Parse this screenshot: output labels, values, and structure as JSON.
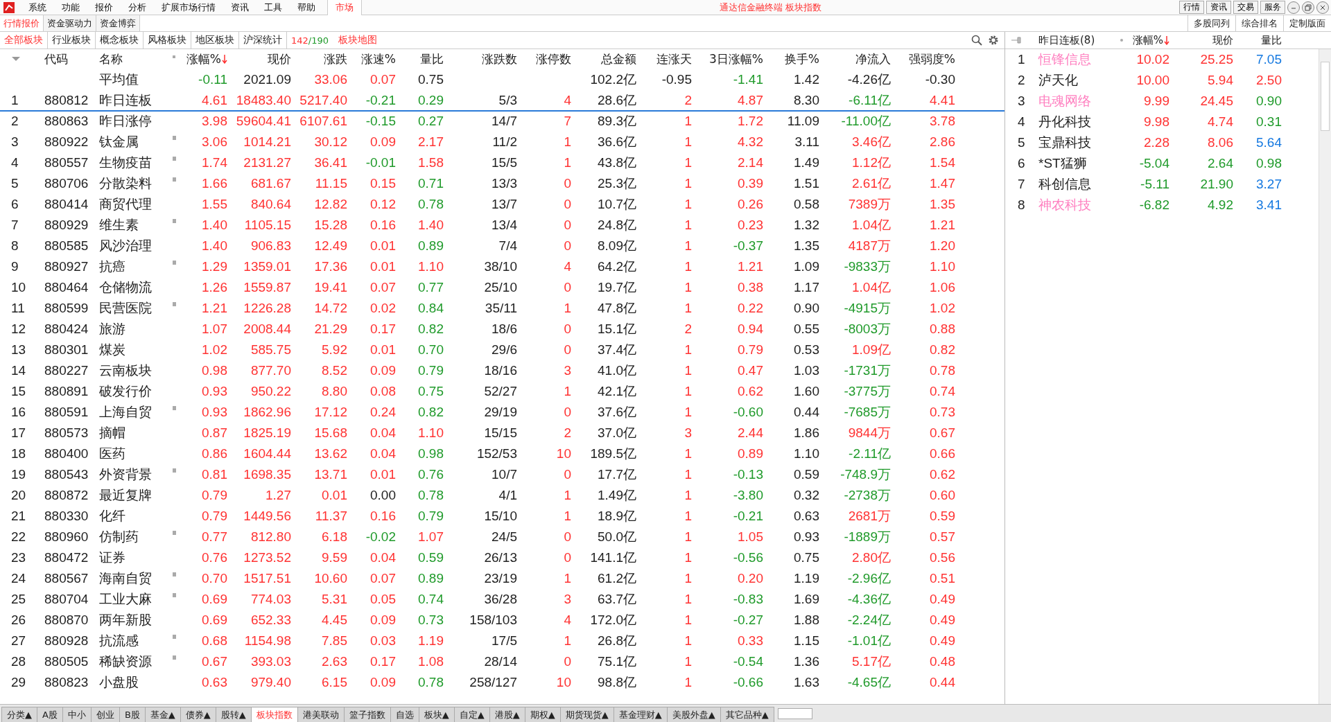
{
  "menubar": {
    "items": [
      {
        "label": "系统",
        "selected": false
      },
      {
        "label": "功能",
        "selected": false
      },
      {
        "label": "报价",
        "selected": false
      },
      {
        "label": "分析",
        "selected": false
      },
      {
        "label": "扩展市场行情",
        "selected": false
      },
      {
        "label": "资讯",
        "selected": false
      },
      {
        "label": "工具",
        "selected": false
      },
      {
        "label": "帮助",
        "selected": false
      },
      {
        "label": "市场",
        "selected": true
      }
    ],
    "title": "通达信金融终端 板块指数",
    "buttons": [
      "行情",
      "资讯",
      "交易",
      "服务"
    ]
  },
  "view_tabs": [
    {
      "label": "行情报价",
      "selected": true
    },
    {
      "label": "资金驱动力",
      "selected": false
    },
    {
      "label": "资金博弈",
      "selected": false
    }
  ],
  "layout_buttons": [
    "多股同列",
    "综合排名",
    "定制版面"
  ],
  "sector_tabs": [
    {
      "label": "全部板块",
      "selected": true
    },
    {
      "label": "行业板块",
      "selected": false
    },
    {
      "label": "概念板块",
      "selected": false
    },
    {
      "label": "风格板块",
      "selected": false
    },
    {
      "label": "地区板块",
      "selected": false
    },
    {
      "label": "沪深统计",
      "selected": false
    }
  ],
  "count": {
    "current": "142",
    "total": "/190"
  },
  "map_link": "板块地图",
  "table": {
    "columns": [
      {
        "sorted": false
      },
      {
        "label": "代码",
        "sorted": false
      },
      {
        "label": "名称",
        "sorted": false
      },
      {
        "label": "涨幅%",
        "sorted": true
      },
      {
        "label": "现价",
        "sorted": false
      },
      {
        "label": "涨跌",
        "sorted": false
      },
      {
        "label": "涨速%",
        "sorted": false
      },
      {
        "label": "量比",
        "sorted": false
      },
      {
        "label": "涨跌数",
        "sorted": false
      },
      {
        "label": "涨停数",
        "sorted": false
      },
      {
        "label": "总金额",
        "sorted": false
      },
      {
        "label": "连涨天",
        "sorted": false
      },
      {
        "label": "3日涨幅%",
        "sorted": false
      },
      {
        "label": "换手%",
        "sorted": false
      },
      {
        "label": "净流入",
        "sorted": false
      },
      {
        "label": "强弱度%",
        "sorted": false
      }
    ],
    "average": {
      "cells": [
        "",
        "",
        "平均值",
        "-0.11",
        "2021.09",
        "33.06",
        "0.07",
        "0.75",
        "",
        "",
        "102.2亿",
        "-0.95",
        "-1.41",
        "1.42",
        "-4.26亿",
        "-0.30"
      ]
    },
    "rows": [
      {
        "cells": [
          "1",
          "880812",
          "昨日连板",
          "4.61",
          "18483.40",
          "5217.40",
          "-0.21",
          "0.29",
          "5/3",
          "4",
          "28.6亿",
          "2",
          "4.87",
          "8.30",
          "-6.11亿",
          "4.41"
        ],
        "marked": false,
        "selected": true
      },
      {
        "cells": [
          "2",
          "880863",
          "昨日涨停",
          "3.98",
          "59604.41",
          "6107.61",
          "-0.15",
          "0.27",
          "14/7",
          "7",
          "89.3亿",
          "1",
          "1.72",
          "11.09",
          "-11.00亿",
          "3.78"
        ],
        "marked": false,
        "selected": false
      },
      {
        "cells": [
          "3",
          "880922",
          "钛金属",
          "3.06",
          "1014.21",
          "30.12",
          "0.09",
          "2.17",
          "11/2",
          "1",
          "36.6亿",
          "1",
          "4.32",
          "3.11",
          "3.46亿",
          "2.86"
        ],
        "marked": true,
        "selected": false
      },
      {
        "cells": [
          "4",
          "880557",
          "生物疫苗",
          "1.74",
          "2131.27",
          "36.41",
          "-0.01",
          "1.58",
          "15/5",
          "1",
          "43.8亿",
          "1",
          "2.14",
          "1.49",
          "1.12亿",
          "1.54"
        ],
        "marked": true,
        "selected": false
      },
      {
        "cells": [
          "5",
          "880706",
          "分散染料",
          "1.66",
          "681.67",
          "11.15",
          "0.15",
          "0.71",
          "13/3",
          "0",
          "25.3亿",
          "1",
          "0.39",
          "1.51",
          "2.61亿",
          "1.47"
        ],
        "marked": true,
        "selected": false
      },
      {
        "cells": [
          "6",
          "880414",
          "商贸代理",
          "1.55",
          "840.64",
          "12.82",
          "0.12",
          "0.78",
          "13/7",
          "0",
          "10.7亿",
          "1",
          "0.26",
          "0.58",
          "7389万",
          "1.35"
        ],
        "marked": false,
        "selected": false
      },
      {
        "cells": [
          "7",
          "880929",
          "维生素",
          "1.40",
          "1105.15",
          "15.28",
          "0.16",
          "1.40",
          "13/4",
          "0",
          "24.8亿",
          "1",
          "0.23",
          "1.32",
          "1.04亿",
          "1.21"
        ],
        "marked": true,
        "selected": false
      },
      {
        "cells": [
          "8",
          "880585",
          "风沙治理",
          "1.40",
          "906.83",
          "12.49",
          "0.01",
          "0.89",
          "7/4",
          "0",
          "8.09亿",
          "1",
          "-0.37",
          "1.35",
          "4187万",
          "1.20"
        ],
        "marked": false,
        "selected": false
      },
      {
        "cells": [
          "9",
          "880927",
          "抗癌",
          "1.29",
          "1359.01",
          "17.36",
          "0.01",
          "1.10",
          "38/10",
          "4",
          "64.2亿",
          "1",
          "1.21",
          "1.09",
          "-9833万",
          "1.10"
        ],
        "marked": true,
        "selected": false
      },
      {
        "cells": [
          "10",
          "880464",
          "仓储物流",
          "1.26",
          "1559.87",
          "19.41",
          "0.07",
          "0.77",
          "25/10",
          "0",
          "19.7亿",
          "1",
          "0.38",
          "1.17",
          "1.04亿",
          "1.06"
        ],
        "marked": false,
        "selected": false
      },
      {
        "cells": [
          "11",
          "880599",
          "民营医院",
          "1.21",
          "1226.28",
          "14.72",
          "0.02",
          "0.84",
          "35/11",
          "1",
          "47.8亿",
          "1",
          "0.22",
          "0.90",
          "-4915万",
          "1.02"
        ],
        "marked": true,
        "selected": false
      },
      {
        "cells": [
          "12",
          "880424",
          "旅游",
          "1.07",
          "2008.44",
          "21.29",
          "0.17",
          "0.82",
          "18/6",
          "0",
          "15.1亿",
          "2",
          "0.94",
          "0.55",
          "-8003万",
          "0.88"
        ],
        "marked": false,
        "selected": false
      },
      {
        "cells": [
          "13",
          "880301",
          "煤炭",
          "1.02",
          "585.75",
          "5.92",
          "0.01",
          "0.70",
          "29/6",
          "0",
          "37.4亿",
          "1",
          "0.79",
          "0.53",
          "1.09亿",
          "0.82"
        ],
        "marked": false,
        "selected": false
      },
      {
        "cells": [
          "14",
          "880227",
          "云南板块",
          "0.98",
          "877.70",
          "8.52",
          "0.09",
          "0.79",
          "18/16",
          "3",
          "41.0亿",
          "1",
          "0.47",
          "1.03",
          "-1731万",
          "0.78"
        ],
        "marked": false,
        "selected": false
      },
      {
        "cells": [
          "15",
          "880891",
          "破发行价",
          "0.93",
          "950.22",
          "8.80",
          "0.08",
          "0.75",
          "52/27",
          "1",
          "42.1亿",
          "1",
          "0.62",
          "1.60",
          "-3775万",
          "0.74"
        ],
        "marked": false,
        "selected": false
      },
      {
        "cells": [
          "16",
          "880591",
          "上海自贸",
          "0.93",
          "1862.96",
          "17.12",
          "0.24",
          "0.82",
          "29/19",
          "0",
          "37.6亿",
          "1",
          "-0.60",
          "0.44",
          "-7685万",
          "0.73"
        ],
        "marked": true,
        "selected": false
      },
      {
        "cells": [
          "17",
          "880573",
          "摘帽",
          "0.87",
          "1825.19",
          "15.68",
          "0.04",
          "1.10",
          "15/15",
          "2",
          "37.0亿",
          "3",
          "2.44",
          "1.86",
          "9844万",
          "0.67"
        ],
        "marked": false,
        "selected": false
      },
      {
        "cells": [
          "18",
          "880400",
          "医药",
          "0.86",
          "1604.44",
          "13.62",
          "0.04",
          "0.98",
          "152/53",
          "10",
          "189.5亿",
          "1",
          "0.89",
          "1.10",
          "-2.11亿",
          "0.66"
        ],
        "marked": false,
        "selected": false
      },
      {
        "cells": [
          "19",
          "880543",
          "外资背景",
          "0.81",
          "1698.35",
          "13.71",
          "0.01",
          "0.76",
          "10/7",
          "0",
          "17.7亿",
          "1",
          "-0.13",
          "0.59",
          "-748.9万",
          "0.62"
        ],
        "marked": true,
        "selected": false
      },
      {
        "cells": [
          "20",
          "880872",
          "最近复牌",
          "0.79",
          "1.27",
          "0.01",
          "0.00",
          "0.78",
          "4/1",
          "1",
          "1.49亿",
          "1",
          "-3.80",
          "0.32",
          "-2738万",
          "0.60"
        ],
        "marked": false,
        "selected": false
      },
      {
        "cells": [
          "21",
          "880330",
          "化纤",
          "0.79",
          "1449.56",
          "11.37",
          "0.16",
          "0.79",
          "15/10",
          "1",
          "18.9亿",
          "1",
          "-0.21",
          "0.63",
          "2681万",
          "0.59"
        ],
        "marked": false,
        "selected": false
      },
      {
        "cells": [
          "22",
          "880960",
          "仿制药",
          "0.77",
          "812.80",
          "6.18",
          "-0.02",
          "1.07",
          "24/5",
          "0",
          "50.0亿",
          "1",
          "1.05",
          "0.93",
          "-1889万",
          "0.57"
        ],
        "marked": true,
        "selected": false
      },
      {
        "cells": [
          "23",
          "880472",
          "证券",
          "0.76",
          "1273.52",
          "9.59",
          "0.04",
          "0.59",
          "26/13",
          "0",
          "141.1亿",
          "1",
          "-0.56",
          "0.75",
          "2.80亿",
          "0.56"
        ],
        "marked": false,
        "selected": false
      },
      {
        "cells": [
          "24",
          "880567",
          "海南自贸",
          "0.70",
          "1517.51",
          "10.60",
          "0.07",
          "0.89",
          "23/19",
          "1",
          "61.2亿",
          "1",
          "0.20",
          "1.19",
          "-2.96亿",
          "0.51"
        ],
        "marked": true,
        "selected": false
      },
      {
        "cells": [
          "25",
          "880704",
          "工业大麻",
          "0.69",
          "774.03",
          "5.31",
          "0.05",
          "0.74",
          "36/28",
          "3",
          "63.7亿",
          "1",
          "-0.83",
          "1.69",
          "-4.36亿",
          "0.49"
        ],
        "marked": true,
        "selected": false
      },
      {
        "cells": [
          "26",
          "880870",
          "两年新股",
          "0.69",
          "652.33",
          "4.45",
          "0.09",
          "0.73",
          "158/103",
          "4",
          "172.0亿",
          "1",
          "-0.27",
          "1.88",
          "-2.24亿",
          "0.49"
        ],
        "marked": false,
        "selected": false
      },
      {
        "cells": [
          "27",
          "880928",
          "抗流感",
          "0.68",
          "1154.98",
          "7.85",
          "0.03",
          "1.19",
          "17/5",
          "1",
          "26.8亿",
          "1",
          "0.33",
          "1.15",
          "-1.01亿",
          "0.49"
        ],
        "marked": true,
        "selected": false
      },
      {
        "cells": [
          "28",
          "880505",
          "稀缺资源",
          "0.67",
          "393.03",
          "2.63",
          "0.17",
          "1.08",
          "28/14",
          "0",
          "75.1亿",
          "1",
          "-0.54",
          "1.36",
          "5.17亿",
          "0.48"
        ],
        "marked": true,
        "selected": false
      },
      {
        "cells": [
          "29",
          "880823",
          "小盘股",
          "0.63",
          "979.40",
          "6.15",
          "0.09",
          "0.78",
          "258/127",
          "10",
          "98.8亿",
          "1",
          "-0.66",
          "1.63",
          "-4.65亿",
          "0.44"
        ],
        "marked": false,
        "selected": false
      }
    ]
  },
  "side_panel": {
    "title": "昨日连板(8)",
    "columns": [
      {
        "label": "涨幅%",
        "sorted": true
      },
      {
        "label": "现价",
        "sorted": false
      },
      {
        "label": "量比",
        "sorted": false
      }
    ],
    "rows": [
      {
        "index": "1",
        "name": "恒锋信息",
        "color": "#ff80c0",
        "change": "10.02",
        "price": "25.25",
        "ratio": "7.05"
      },
      {
        "index": "2",
        "name": "泸天化",
        "color": "#222222",
        "change": "10.00",
        "price": "5.94",
        "ratio": "2.50"
      },
      {
        "index": "3",
        "name": "电魂网络",
        "color": "#ff80c0",
        "change": "9.99",
        "price": "24.45",
        "ratio": "0.90"
      },
      {
        "index": "4",
        "name": "丹化科技",
        "color": "#222222",
        "change": "9.98",
        "price": "4.74",
        "ratio": "0.31"
      },
      {
        "index": "5",
        "name": "宝鼎科技",
        "color": "#222222",
        "change": "2.28",
        "price": "8.06",
        "ratio": "5.64"
      },
      {
        "index": "6",
        "name": "*ST猛狮",
        "color": "#222222",
        "change": "-5.04",
        "price": "2.64",
        "ratio": "0.98"
      },
      {
        "index": "7",
        "name": "科创信息",
        "color": "#222222",
        "change": "-5.11",
        "price": "21.90",
        "ratio": "3.27"
      },
      {
        "index": "8",
        "name": "神农科技",
        "color": "#ff80c0",
        "change": "-6.82",
        "price": "4.92",
        "ratio": "3.41"
      }
    ]
  },
  "bottom_tabs": [
    {
      "label": "分类▲",
      "selected": false
    },
    {
      "label": "A股",
      "selected": false
    },
    {
      "label": "中小",
      "selected": false
    },
    {
      "label": "创业",
      "selected": false
    },
    {
      "label": "B股",
      "selected": false
    },
    {
      "label": "基金▲",
      "selected": false
    },
    {
      "label": "债券▲",
      "selected": false
    },
    {
      "label": "股转▲",
      "selected": false
    },
    {
      "label": "板块指数",
      "selected": true
    },
    {
      "label": "港美联动",
      "selected": false
    },
    {
      "label": "篮子指数",
      "selected": false
    },
    {
      "label": "自选",
      "selected": false
    },
    {
      "label": "板块▲",
      "selected": false
    },
    {
      "label": "自定▲",
      "selected": false
    },
    {
      "label": "港股▲",
      "selected": false
    },
    {
      "label": "期权▲",
      "selected": false
    },
    {
      "label": "期货现货▲",
      "selected": false
    },
    {
      "label": "基金理财▲",
      "selected": false
    },
    {
      "label": "美股外盘▲",
      "selected": false
    },
    {
      "label": "其它品种▲",
      "selected": false
    }
  ]
}
